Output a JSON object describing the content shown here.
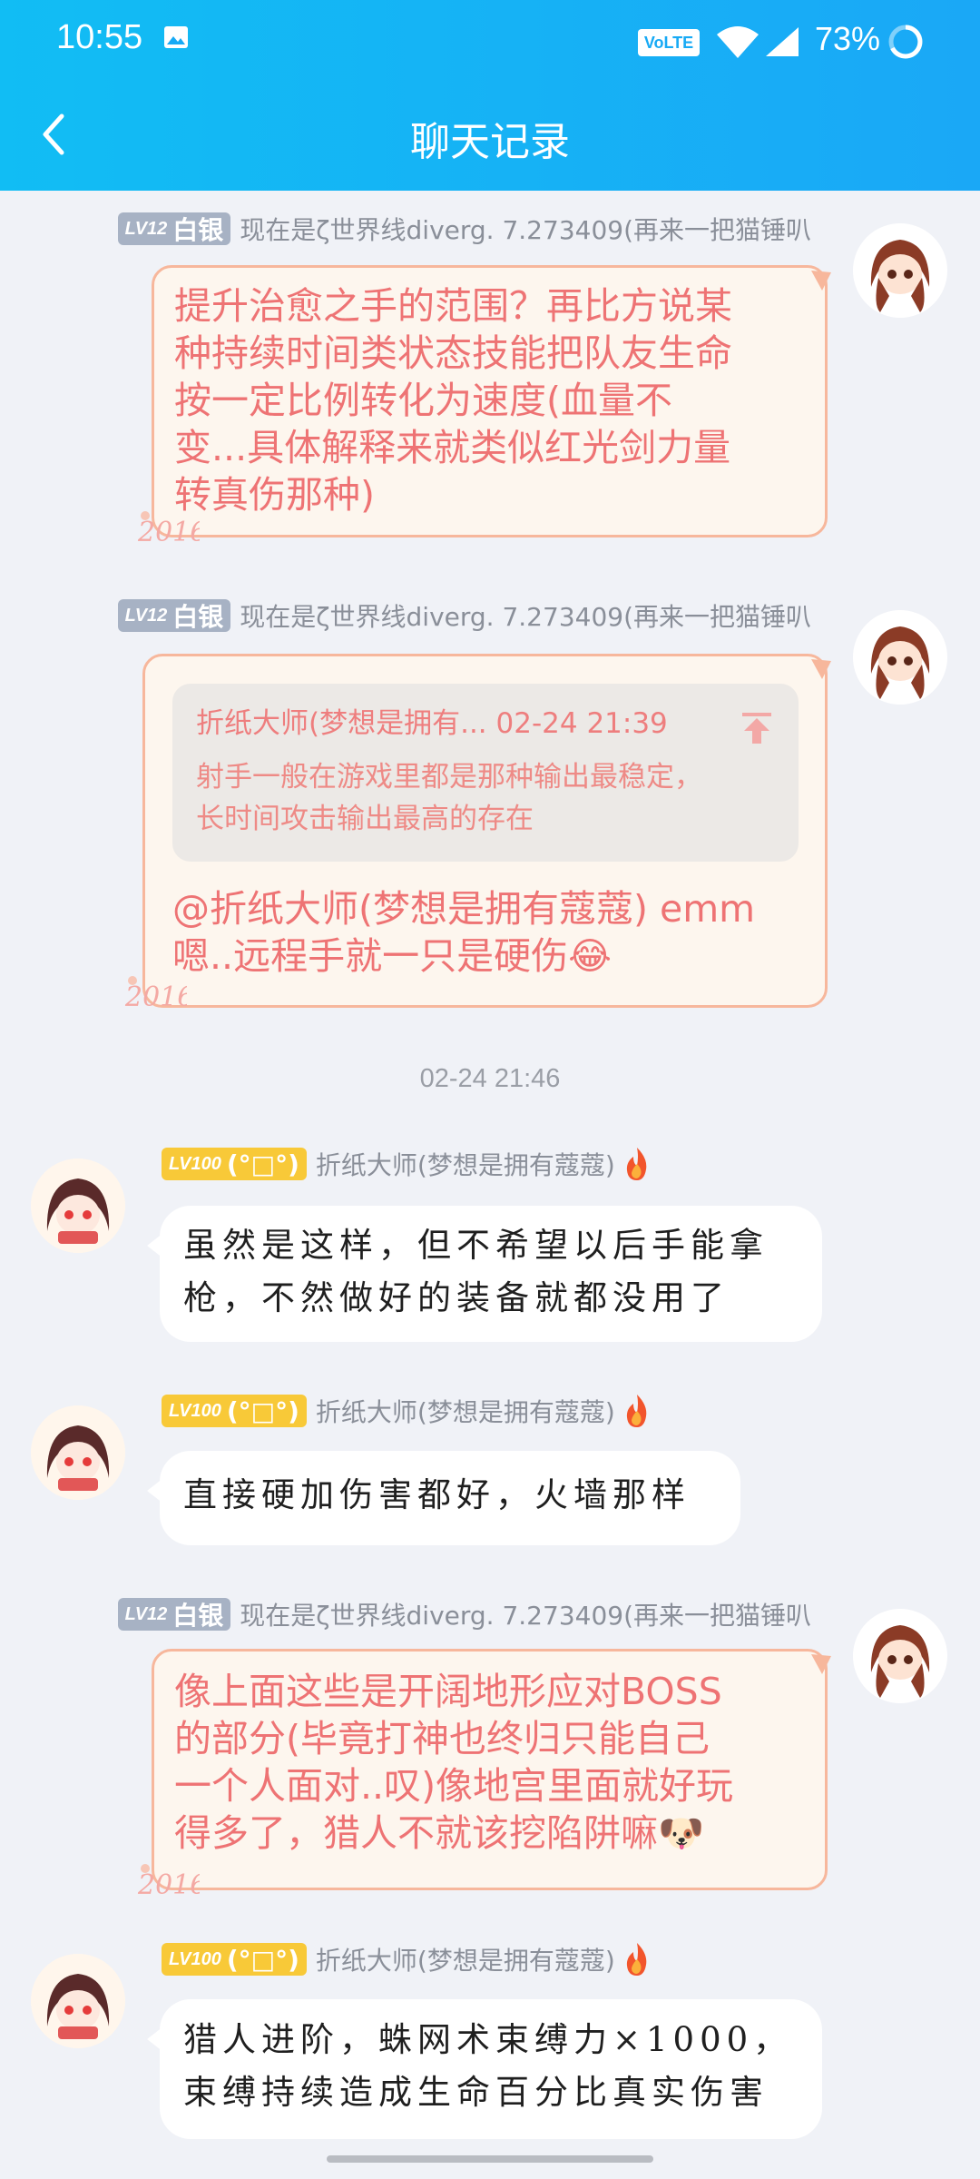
{
  "status_bar": {
    "time": "10:55",
    "network_badge": "VoLTE",
    "battery": "73%"
  },
  "nav": {
    "title": "聊天记录"
  },
  "users": {
    "me": {
      "level": "LV12",
      "rank": "白银",
      "name": "现在是ζ世界线diverg. 7.273409(再来一把猫锤叭"
    },
    "other": {
      "level": "LV100",
      "rank": "(°□°)",
      "name": "折纸大师(梦想是拥有蔻蔻)"
    }
  },
  "messages": [
    {
      "sender": "me",
      "lines": [
        "提升治愈之手的范围？再比方说某",
        "种持续时间类状态技能把队友生命",
        "按一定比例转化为速度(血量不",
        "变...具体解释来就类似红光剑力量",
        "转真伤那种)"
      ]
    },
    {
      "sender": "me",
      "quote": {
        "author": "折纸大师(梦想是拥有... 02-24 21:39",
        "lines": [
          "射手一般在游戏里都是那种输出最稳定，",
          "长时间攻击输出最高的存在"
        ]
      },
      "lines": [
        "@折纸大师(梦想是拥有蔻蔻) emm",
        "嗯..远程手就一只是硬伤😂"
      ]
    },
    {
      "sender": "timestamp",
      "text": "02-24 21:46"
    },
    {
      "sender": "other",
      "lines": [
        "虽然是这样，但不希望以后手能拿",
        "枪，不然做好的装备就都没用了"
      ]
    },
    {
      "sender": "other",
      "lines": [
        "直接硬加伤害都好，火墙那样"
      ]
    },
    {
      "sender": "me",
      "lines": [
        "像上面这些是开阔地形应对BOSS",
        "的部分(毕竟打神也终归只能自己",
        "一个人面对..叹)像地宫里面就好玩",
        "得多了，猎人不就该挖陷阱嘛🐶"
      ]
    },
    {
      "sender": "other",
      "lines": [
        "猎人进阶，蛛网术束缚力×1000，",
        "束缚持续造成生命百分比真实伤害"
      ]
    }
  ],
  "colors": {
    "header": "#17b1f5",
    "bubble_me_text": "#ee7374",
    "bubble_me_border": "#f7b79c",
    "level_silver": "#a7b2c4",
    "level_gold": "#f8c938"
  },
  "icons": [
    "image-icon",
    "wifi-icon",
    "signal-icon",
    "battery-ring-icon",
    "back-arrow-icon",
    "pin-top-icon",
    "flame-icon"
  ]
}
